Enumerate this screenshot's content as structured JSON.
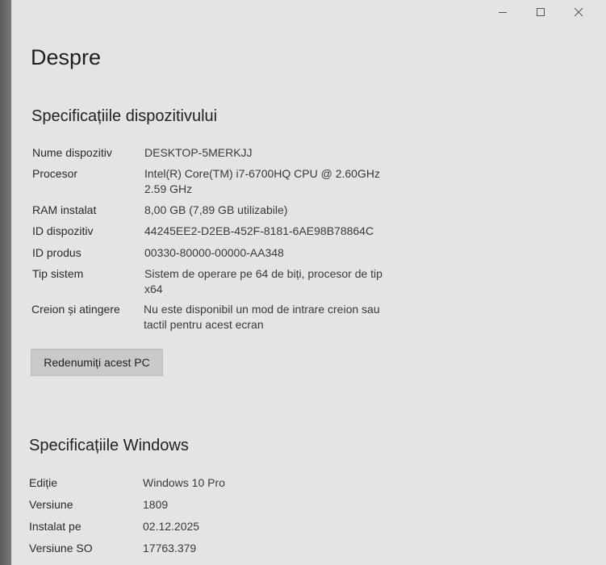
{
  "window": {
    "controls": {
      "minimize": "minimize-icon",
      "maximize": "maximize-icon",
      "close": "close-icon"
    }
  },
  "page": {
    "title": "Despre"
  },
  "device_specs": {
    "title": "Specificațiile dispozitivului",
    "rows": [
      {
        "label": "Nume dispozitiv",
        "value": "DESKTOP-5MERKJJ"
      },
      {
        "label": "Procesor",
        "value": "Intel(R) Core(TM) i7-6700HQ CPU @ 2.60GHz\n2.59 GHz"
      },
      {
        "label": "RAM instalat",
        "value": "8,00 GB (7,89 GB utilizabile)"
      },
      {
        "label": "ID dispozitiv",
        "value": "44245EE2-D2EB-452F-8181-6AE98B78864C"
      },
      {
        "label": "ID produs",
        "value": "00330-80000-00000-AA348"
      },
      {
        "label": "Tip sistem",
        "value": "Sistem de operare pe 64 de biți, procesor de tip\nx64"
      },
      {
        "label": "Creion și atingere",
        "value": "Nu este disponibil un mod de intrare creion sau\ntactil pentru acest ecran"
      }
    ],
    "rename_button": "Redenumiți acest PC"
  },
  "windows_specs": {
    "title": "Specificațiile Windows",
    "rows": [
      {
        "label": "Ediție",
        "value": "Windows 10 Pro"
      },
      {
        "label": "Versiune",
        "value": "1809"
      },
      {
        "label": "Instalat pe",
        "value": "02.12.2025"
      },
      {
        "label": "Versiune SO",
        "value": "17763.379"
      }
    ]
  },
  "colors": {
    "background": "#e4e4e3",
    "button": "#c9c9c8",
    "text": "#1f1f1f"
  }
}
